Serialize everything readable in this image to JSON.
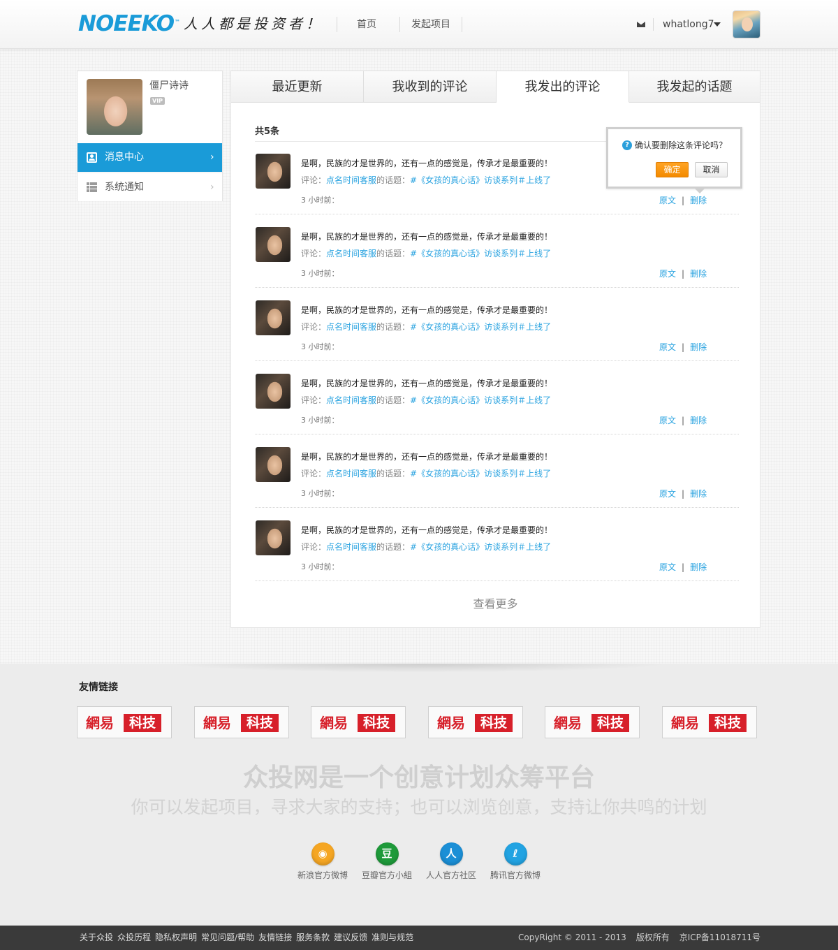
{
  "header": {
    "logo": "NOEEKO",
    "logo_tm": "™",
    "slogan": "人人都是投资者！",
    "nav": [
      "首页",
      "发起项目"
    ],
    "username": "whatlong7"
  },
  "sidebar": {
    "profile_name": "僵尸诗诗",
    "badge": "VIP",
    "items": [
      {
        "label": "消息中心"
      },
      {
        "label": "系统通知"
      }
    ]
  },
  "tabs": [
    {
      "label": "最近更新"
    },
    {
      "label": "我收到的评论"
    },
    {
      "label": "我发出的评论"
    },
    {
      "label": "我发起的话题"
    }
  ],
  "list": {
    "total": "共5条",
    "items": [
      {
        "text": "是啊，民族的才是世界的，还有一点的感觉是，传承才是最重要的！",
        "prefix": "评论：",
        "author": "点名时间客服",
        "mid": "的话题：",
        "topic": "#《女孩的真心话》访谈系列＃上线了",
        "time": "3 小时前：",
        "orig": "原文",
        "del": "删除"
      },
      {
        "text": "是啊，民族的才是世界的，还有一点的感觉是，传承才是最重要的！",
        "prefix": "评论：",
        "author": "点名时间客服",
        "mid": "的话题：",
        "topic": "#《女孩的真心话》访谈系列＃上线了",
        "time": "3 小时前：",
        "orig": "原文",
        "del": "删除"
      },
      {
        "text": "是啊，民族的才是世界的，还有一点的感觉是，传承才是最重要的！",
        "prefix": "评论：",
        "author": "点名时间客服",
        "mid": "的话题：",
        "topic": "#《女孩的真心话》访谈系列＃上线了",
        "time": "3 小时前：",
        "orig": "原文",
        "del": "删除"
      },
      {
        "text": "是啊，民族的才是世界的，还有一点的感觉是，传承才是最重要的！",
        "prefix": "评论：",
        "author": "点名时间客服",
        "mid": "的话题：",
        "topic": "#《女孩的真心话》访谈系列＃上线了",
        "time": "3 小时前：",
        "orig": "原文",
        "del": "删除"
      },
      {
        "text": "是啊，民族的才是世界的，还有一点的感觉是，传承才是最重要的！",
        "prefix": "评论：",
        "author": "点名时间客服",
        "mid": "的话题：",
        "topic": "#《女孩的真心话》访谈系列＃上线了",
        "time": "3 小时前：",
        "orig": "原文",
        "del": "删除"
      },
      {
        "text": "是啊，民族的才是世界的，还有一点的感觉是，传承才是最重要的！",
        "prefix": "评论：",
        "author": "点名时间客服",
        "mid": "的话题：",
        "topic": "#《女孩的真心话》访谈系列＃上线了",
        "time": "3 小时前：",
        "orig": "原文",
        "del": "删除"
      }
    ],
    "more": "查看更多"
  },
  "popup": {
    "message": "确认要删除这条评论吗？",
    "confirm": "确定",
    "cancel": "取消"
  },
  "footer": {
    "friends_title": "友情链接",
    "partners": [
      {
        "a": "網易",
        "b": "科技"
      },
      {
        "a": "網易",
        "b": "科技"
      },
      {
        "a": "網易",
        "b": "科技"
      },
      {
        "a": "網易",
        "b": "科技"
      },
      {
        "a": "網易",
        "b": "科技"
      },
      {
        "a": "網易",
        "b": "科技"
      }
    ],
    "headline": "众投网是一个创意计划众筹平台",
    "subline": "你可以发起项目，寻求大家的支持；也可以浏览创意，支持让你共鸣的计划",
    "socials": [
      {
        "label": "新浪官方微博",
        "color": "#f5a623",
        "glyph": "◉"
      },
      {
        "label": "豆瓣官方小組",
        "color": "#1e9a3a",
        "glyph": "豆"
      },
      {
        "label": "人人官方社区",
        "color": "#1b8fd6",
        "glyph": "人"
      },
      {
        "label": "腾讯官方微博",
        "color": "#22a3e2",
        "glyph": "ℓ"
      }
    ],
    "links": [
      "关于众投",
      "众投历程",
      "隐私权声明",
      "常见问题/帮助",
      "友情链接",
      "服务条款",
      "建议反馈",
      "准则与规范"
    ],
    "copyright": "CopyRight © 2011 - 2013",
    "rights": "版权所有",
    "icp": "京ICP备11018711号"
  }
}
